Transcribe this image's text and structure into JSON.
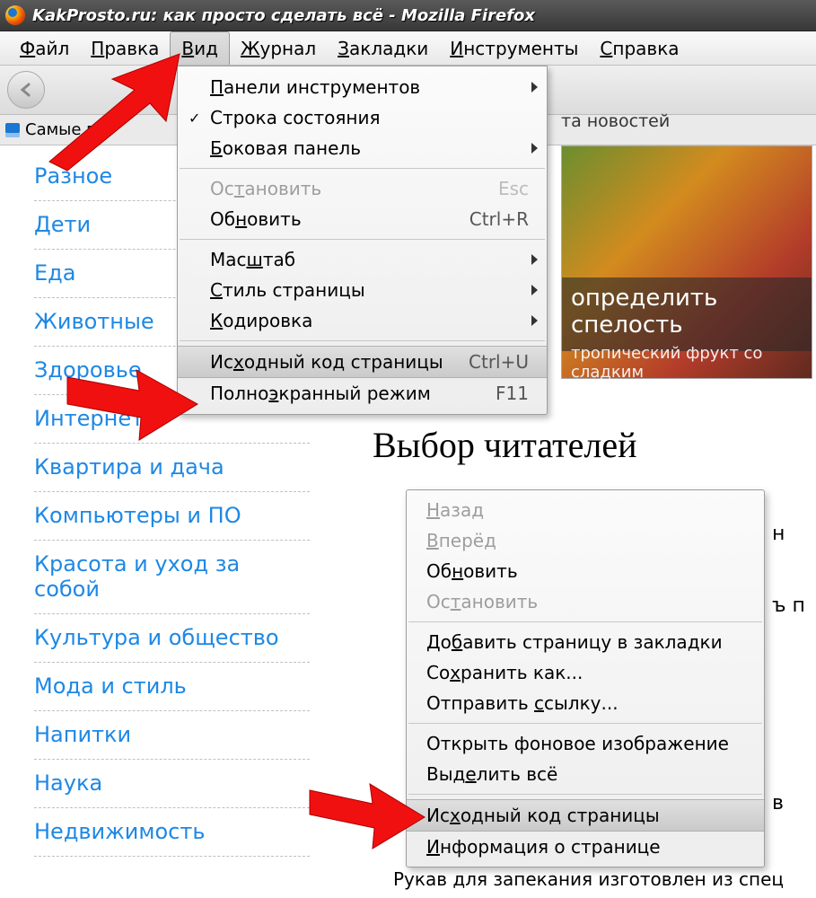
{
  "window": {
    "title": "KakProsto.ru: как просто сделать всё - Mozilla Firefox"
  },
  "menubar": {
    "file": {
      "label": "Файл",
      "ul": "Ф"
    },
    "edit": {
      "label": "Правка",
      "ul": "П"
    },
    "view": {
      "label": "Вид",
      "ul": "В"
    },
    "history": {
      "label": "Журнал",
      "ul": "Ж"
    },
    "bookmarks": {
      "label": "Закладки",
      "ul": "З"
    },
    "tools": {
      "label": "Инструменты",
      "ul": "И"
    },
    "help": {
      "label": "Справка",
      "ul": "С"
    }
  },
  "bookmarksbar": {
    "label": "Самые популярные",
    "visible_partial": "Самые п",
    "tail": "та новостей"
  },
  "sidebar": {
    "items": [
      "Разное",
      "Дети",
      "Еда",
      "Животные",
      "Здоровье",
      "Интернет",
      "Квартира и дача",
      "Компьютеры и ПО",
      "Красота и уход за собой",
      "Культура и общество",
      "Мода и стиль",
      "Напитки",
      "Наука",
      "Недвижимость"
    ]
  },
  "banner": {
    "line1": "определить спелость",
    "line2": "тропический фрукт со сладким"
  },
  "main": {
    "heading": "Выбор читателей",
    "truncated_footer": "Рукав для запекания изготовлен из спец"
  },
  "view_menu": {
    "toolbars": {
      "label": "Панели инструментов",
      "submenu": true
    },
    "statusbar": {
      "label": "Строка состояния",
      "checked": true
    },
    "sidebarp": {
      "label": "Боковая панель",
      "submenu": true
    },
    "stop": {
      "label": "Остановить",
      "shortcut": "Esc",
      "disabled": true
    },
    "reload": {
      "label": "Обновить",
      "shortcut": "Ctrl+R"
    },
    "zoom": {
      "label": "Масштаб",
      "submenu": true
    },
    "pagestyle": {
      "label": "Стиль страницы",
      "submenu": true
    },
    "encoding": {
      "label": "Кодировка",
      "submenu": true
    },
    "source": {
      "label": "Исходный код страницы",
      "shortcut": "Ctrl+U",
      "highlight": true
    },
    "fullscreen": {
      "label": "Полноэкранный режим",
      "shortcut": "F11"
    }
  },
  "context_menu": {
    "back": {
      "label": "Назад",
      "disabled": true
    },
    "forward": {
      "label": "Вперёд",
      "disabled": true
    },
    "reload": {
      "label": "Обновить"
    },
    "stop": {
      "label": "Остановить",
      "disabled": true
    },
    "bookmark": {
      "label": "Добавить страницу в закладки"
    },
    "saveas": {
      "label": "Сохранить как..."
    },
    "sendlink": {
      "label": "Отправить ссылку..."
    },
    "openbg": {
      "label": "Открыть фоновое изображение"
    },
    "selectall": {
      "label": "Выделить всё"
    },
    "source": {
      "label": "Исходный код страницы",
      "highlight": true
    },
    "pageinfo": {
      "label": "Информация о странице"
    }
  }
}
